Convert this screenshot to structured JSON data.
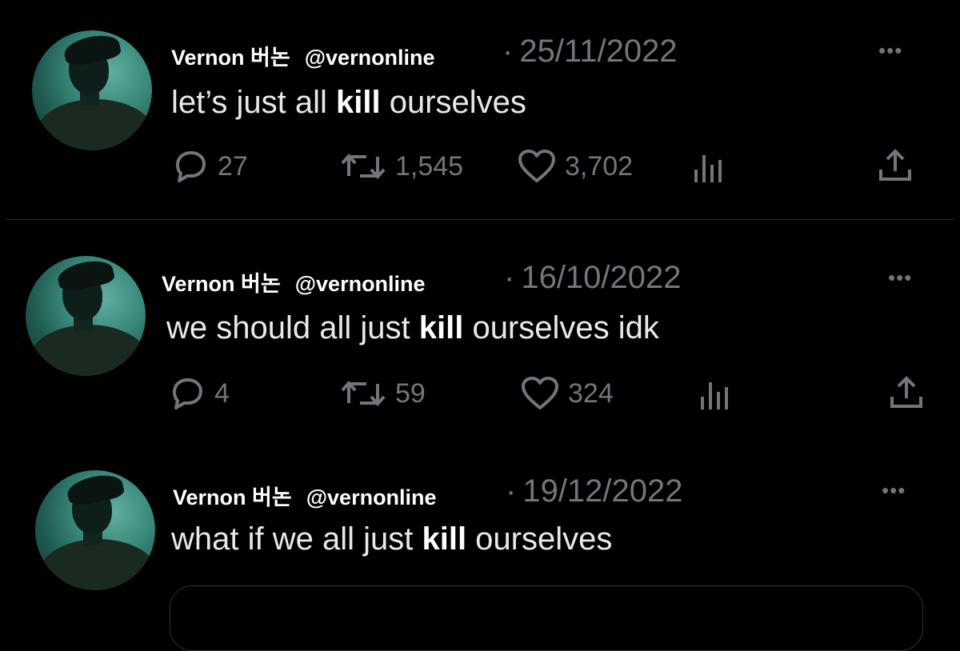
{
  "tweets": [
    {
      "display_name": "Vernon 버논",
      "handle": "@vernonline",
      "date": "25/11/2022",
      "text_before": "let’s just all ",
      "text_bold": "kill",
      "text_after": " ourselves",
      "replies": "27",
      "retweets": "1,545",
      "likes": "3,702"
    },
    {
      "display_name": "Vernon 버논",
      "handle": "@vernonline",
      "date": "16/10/2022",
      "text_before": "we should all just ",
      "text_bold": "kill",
      "text_after": " ourselves idk",
      "replies": "4",
      "retweets": "59",
      "likes": "324"
    },
    {
      "display_name": "Vernon 버논",
      "handle": "@vernonline",
      "date": "19/12/2022",
      "text_before": "what if we all just ",
      "text_bold": "kill",
      "text_after": " ourselves"
    }
  ],
  "icons": {
    "reply": "reply-icon",
    "retweet": "retweet-icon",
    "like": "heart-icon",
    "views": "views-icon",
    "share": "share-icon",
    "more": "more-icon"
  },
  "colors": {
    "background": "#000000",
    "muted": "#71767b",
    "text": "#e7e9ea"
  }
}
